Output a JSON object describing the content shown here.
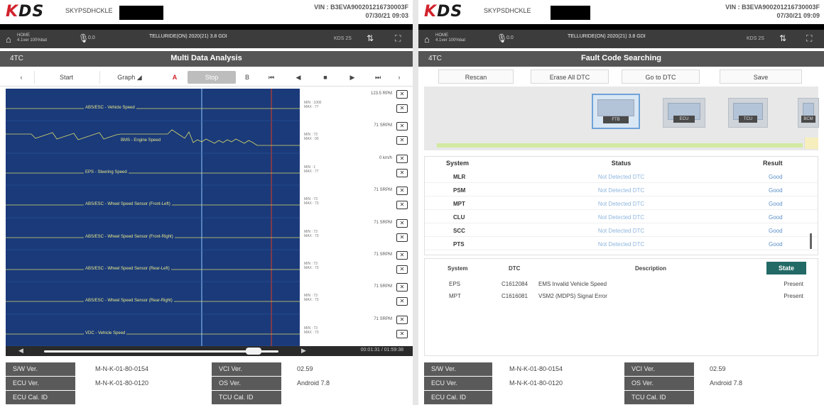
{
  "left": {
    "brand": {
      "logo_accent": "K",
      "logo_text": "DS",
      "device_id": "SKYPSDHCKLE",
      "vin_line1": "VIN : B3EVA900201216730003F",
      "vin_line2": "07/30/21 09:03"
    },
    "topbar": {
      "home_line1": "HOME",
      "home_line2": "4.1ver   100%bat",
      "mic_text": "0.0",
      "vehicle": "TELLURIDE(ON) 2020(21) 3.8 GDI",
      "unit_text": "KDS 2S"
    },
    "title": "Multi Data Analysis",
    "back_label": "4TC",
    "controls": [
      {
        "label": "‹",
        "name": "prev-control"
      },
      {
        "label": "Start",
        "name": "start-button"
      },
      {
        "label": "Graph",
        "name": "graph-button"
      },
      {
        "label": "A",
        "name": "a-marker-button"
      },
      {
        "label": "Stop",
        "name": "stop-button"
      },
      {
        "label": "B",
        "name": "b-marker-button"
      },
      {
        "label": "⏮",
        "name": "skip-back-button"
      },
      {
        "label": "◀",
        "name": "step-back-button"
      },
      {
        "label": "■",
        "name": "stop-playback-button"
      },
      {
        "label": "▶",
        "name": "play-button"
      },
      {
        "label": "⏭",
        "name": "skip-forward-button"
      },
      {
        "label": "›",
        "name": "next-control"
      }
    ],
    "signals": [
      {
        "label": "ABS/ESC - Vehicle Speed",
        "value": "123.5 RPM",
        "min": "MIN : 1000",
        "max": "MAX : 77"
      },
      {
        "label": "BMS - Engine Speed",
        "value": "71 SRPM",
        "min": "MIN : 73",
        "max": "MAX : 00"
      },
      {
        "label": "EPS - Steering Speed",
        "value": "0 km/h",
        "min": "MIN : 1",
        "max": "MAX : 77"
      },
      {
        "label": "ABS/ESC - Wheel Speed Sensor (Front-Left)",
        "value": "71 SRPM",
        "min": "MIN : 73",
        "max": "MAX : 73"
      },
      {
        "label": "ABS/ESC - Wheel Speed Sensor (Front-Right)",
        "value": "71 SRPM",
        "min": "MIN : 73",
        "max": "MAX : 73"
      },
      {
        "label": "ABS/ESC - Wheel Speed Sensor (Rear-Left)",
        "value": "71 SRPM",
        "min": "MIN : 73",
        "max": "MAX : 73"
      },
      {
        "label": "ABS/ESC - Wheel Speed Sensor (Rear-Right)",
        "value": "71 SRPM",
        "min": "MIN : 73",
        "max": "MAX : 73"
      },
      {
        "label": "VDC - Vehicle Speed",
        "value": "71 SRPM",
        "min": "MIN : 73",
        "max": "MAX : 73"
      }
    ],
    "scroll_time": "00:01:31 / 01:59:38",
    "info": [
      {
        "label1": "S/W Ver.",
        "value1": "M-N-K-01-80-0154",
        "label2": "VCI Ver.",
        "value2": "02.59"
      },
      {
        "label1": "ECU Ver.",
        "value1": "M-N-K-01-80-0120",
        "label2": "OS Ver.",
        "value2": "Android 7.8"
      },
      {
        "label1": "ECU Cal. ID",
        "value1": "",
        "label2": "TCU Cal. ID",
        "value2": ""
      }
    ]
  },
  "right": {
    "brand": {
      "logo_accent": "K",
      "logo_text": "DS",
      "device_id": "SKYPSDHCKLE",
      "vin_line1": "VIN : B3EVA900201216730003F",
      "vin_line2": "07/30/21 09:09"
    },
    "topbar": {
      "home_line1": "HOME",
      "home_line2": "4.1ver   100%bat",
      "mic_text": "0.0",
      "vehicle": "TELLURIDE(ON) 2020(21) 3.8 GDI",
      "unit_text": "KDS 2S"
    },
    "title": "Fault Code Searching",
    "back_label": "4TC",
    "buttons": [
      "Rescan",
      "Erase All DTC",
      "Go to DTC",
      "Save"
    ],
    "ecu_tiles": [
      "FTB",
      "ECU",
      "TCU",
      "BCM"
    ],
    "system_headers": {
      "system": "System",
      "status": "Status",
      "result": "Result"
    },
    "systems": [
      {
        "name": "MLR",
        "status": "Not Detected DTC",
        "result": "Good"
      },
      {
        "name": "PSM",
        "status": "Not Detected DTC",
        "result": "Good"
      },
      {
        "name": "MPT",
        "status": "Not Detected DTC",
        "result": "Good"
      },
      {
        "name": "CLU",
        "status": "Not Detected DTC",
        "result": "Good"
      },
      {
        "name": "SCC",
        "status": "Not Detected DTC",
        "result": "Good"
      },
      {
        "name": "PTS",
        "status": "Not Detected DTC",
        "result": "Good"
      }
    ],
    "dtc_headers": {
      "system": "System",
      "dtc": "DTC",
      "description": "Description",
      "state": "State"
    },
    "dtcs": [
      {
        "system": "EPS",
        "dtc": "C1612084",
        "description": "EMS Invalid Vehicle Speed",
        "state": "Present"
      },
      {
        "system": "MPT",
        "dtc": "C1616081",
        "description": "VSM2 (MDPS) Signal Error",
        "state": "Present"
      }
    ],
    "info": [
      {
        "label1": "S/W Ver.",
        "value1": "M-N-K-01-80-0154",
        "label2": "VCI Ver.",
        "value2": "02.59"
      },
      {
        "label1": "ECU Ver.",
        "value1": "M-N-K-01-80-0120",
        "label2": "OS Ver.",
        "value2": "Android 7.8"
      },
      {
        "label1": "ECU Cal. ID",
        "value1": "",
        "label2": "TCU Cal. ID",
        "value2": ""
      }
    ]
  },
  "colors": {
    "brand_red": "#d2222b",
    "chart_bg": "#1a3a7a",
    "state_button": "#236a66",
    "good": "#5b8fc9"
  }
}
